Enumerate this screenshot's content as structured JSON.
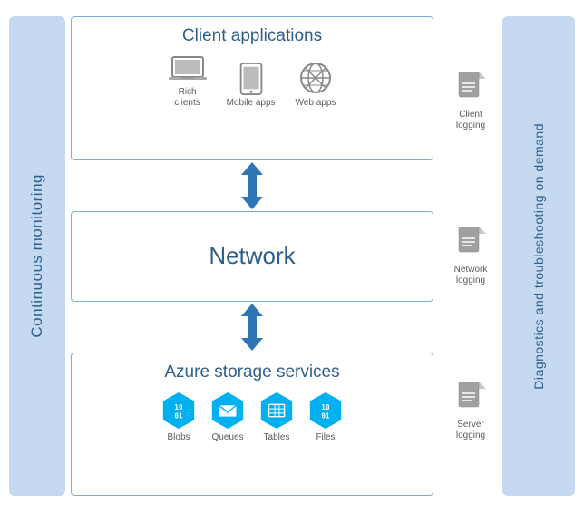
{
  "left_label": "Continuous monitoring",
  "right_label": "Diagnostics and troubleshooting on demand",
  "client_box": {
    "title": "Client applications",
    "icons": [
      {
        "name": "rich-clients-icon",
        "label": "Rich\nclients"
      },
      {
        "name": "mobile-apps-icon",
        "label": "Mobile apps"
      },
      {
        "name": "web-apps-icon",
        "label": "Web apps"
      }
    ]
  },
  "network_box": {
    "title": "Network"
  },
  "azure_box": {
    "title": "Azure storage services",
    "icons": [
      {
        "name": "blobs-icon",
        "label": "Blobs"
      },
      {
        "name": "queues-icon",
        "label": "Queues"
      },
      {
        "name": "tables-icon",
        "label": "Tables"
      },
      {
        "name": "files-icon",
        "label": "Files"
      }
    ]
  },
  "right_logs": [
    {
      "name": "client-logging",
      "label": "Client\nlogging"
    },
    {
      "name": "network-logging",
      "label": "Network\nlogging"
    },
    {
      "name": "server-logging",
      "label": "Server\nlogging"
    }
  ],
  "colors": {
    "accent": "#2e75b6",
    "panel_bg": "#c5d9f1",
    "label_text": "#2e5f8a",
    "border": "#7bafd4",
    "hex_blue": "#00b0f0",
    "icon_gray": "#8c8c8c"
  }
}
